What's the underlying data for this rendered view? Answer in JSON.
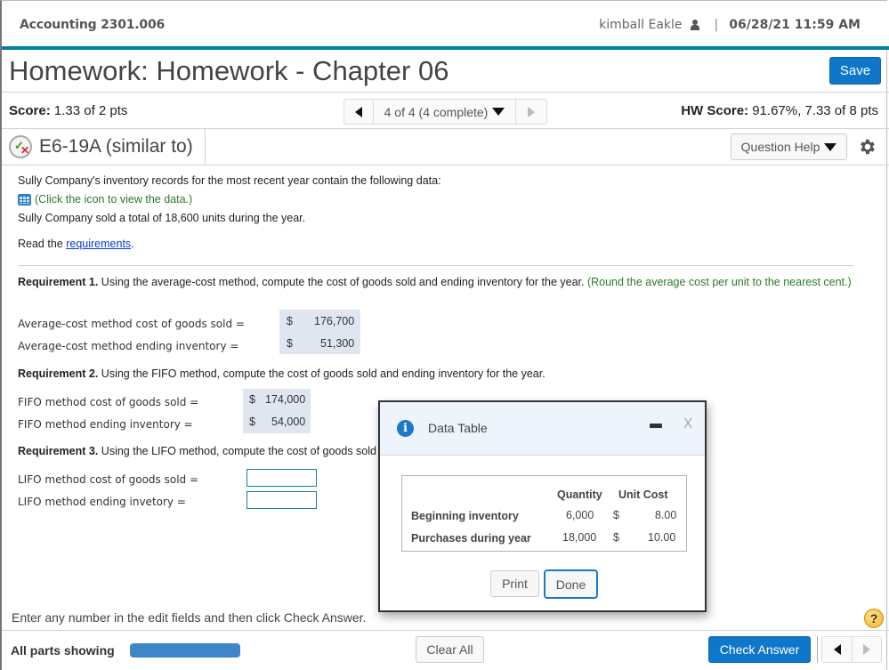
{
  "header": {
    "course": "Accounting 2301.006",
    "user_name": "kimball Eakle",
    "separator": "|",
    "datetime": "06/28/21 11:59 AM"
  },
  "title_bar": {
    "title": "Homework: Homework - Chapter 06",
    "save_label": "Save"
  },
  "score_bar": {
    "score_label": "Score:",
    "score_value": "1.33 of 2 pts",
    "question_nav": "4 of 4 (4 complete)",
    "hw_score_label": "HW Score:",
    "hw_score_value": "91.67%, 7.33 of 8 pts"
  },
  "question_header": {
    "question_id": "E6-19A (similar to)",
    "help_label": "Question Help"
  },
  "problem": {
    "intro": "Sully Company's inventory records for the most recent year contain the following data:",
    "data_link": "(Click the icon to view the data.)",
    "units_sold": "Sully Company sold a total of 18,600 units during the year.",
    "read_prefix": "Read the ",
    "requirements_link": "requirements",
    "read_suffix": "."
  },
  "requirement1": {
    "label": "Requirement 1.",
    "text": " Using the average-cost method, compute the cost of goods sold and ending inventory for the year.",
    "hint": " (Round the average cost per unit to the nearest cent.)",
    "rows": [
      {
        "label": "Average-cost method cost of goods sold =",
        "currency": "$",
        "value": "176,700"
      },
      {
        "label": "Average-cost method ending inventory =",
        "currency": "$",
        "value": "51,300"
      }
    ]
  },
  "requirement2": {
    "label": "Requirement 2.",
    "text": " Using the FIFO method, compute the cost of goods sold and ending inventory for the year.",
    "rows": [
      {
        "label": "FIFO method cost of goods sold =",
        "currency": "$",
        "value": "174,000"
      },
      {
        "label": "FIFO method ending inventory =",
        "currency": "$",
        "value": "54,000"
      }
    ]
  },
  "requirement3": {
    "label": "Requirement 3.",
    "text": " Using the LIFO method, compute the cost of goods sold and ending inventory for the year.",
    "rows": [
      {
        "label": "LIFO method cost of goods sold =",
        "value": ""
      },
      {
        "label": "LIFO method ending invetory =",
        "value": ""
      }
    ]
  },
  "instruction": "Enter any number in the edit fields and then click Check Answer.",
  "help_icon": "?",
  "footer": {
    "parts_label": "All parts showing",
    "parts_progress": 1.0,
    "clear_label": "Clear All",
    "check_label": "Check Answer"
  },
  "dialog": {
    "title": "Data Table",
    "info_glyph": "i",
    "close_glyph": "X",
    "table": {
      "headers": [
        "Quantity",
        "Unit Cost"
      ],
      "rows": [
        {
          "label": "Beginning inventory",
          "quantity": "6,000",
          "currency": "$",
          "unit_cost": "8.00"
        },
        {
          "label": "Purchases during year",
          "quantity": "18,000",
          "currency": "$",
          "unit_cost": "10.00"
        }
      ]
    },
    "print_label": "Print",
    "done_label": "Done"
  },
  "colors": {
    "accent_blue": "#0e77c9",
    "header_rule": "#007fa3",
    "hint_green": "#2b7a2b",
    "link_blue": "#0b3bd6",
    "answer_bg": "#e0e6f0"
  }
}
